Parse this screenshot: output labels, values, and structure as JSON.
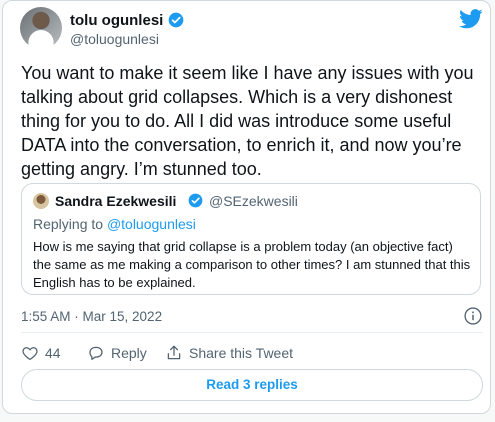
{
  "author": {
    "name": "tolu ogunlesi",
    "handle": "@toluogunlesi"
  },
  "tweet": {
    "text": "You want to make it seem like I have any issues with you\ntalking about grid collapses. Which is a very dishonest\nthing for you to do. All I did was introduce some useful\nDATA into the conversation, to enrich it, and now you’re\ngetting angry. I’m stunned too.",
    "timestamp": "1:55 AM · Mar 15, 2022"
  },
  "quoted": {
    "name": "Sandra Ezekwesili",
    "handle": "@SEzekwesili",
    "replying_prefix": "Replying to ",
    "replying_handle": "@toluogunlesi",
    "text": "How is me saying that grid collapse is a problem today (an objective fact) the same as me making a comparison to other times? I am stunned that this English has to be explained."
  },
  "actions": {
    "likes": "44",
    "reply_label": "Reply",
    "share_label": "Share this Tweet"
  },
  "read_replies_label": "Read 3 replies",
  "icons": {
    "verified": "verified-badge-icon",
    "brand": "twitter-bird-icon",
    "info": "info-icon",
    "like": "heart-icon",
    "reply": "reply-bubble-icon",
    "share": "share-icon"
  },
  "colors": {
    "accent": "#1d9bf0",
    "text": "#0f1419",
    "muted": "#536471",
    "border": "#cfd9de"
  }
}
